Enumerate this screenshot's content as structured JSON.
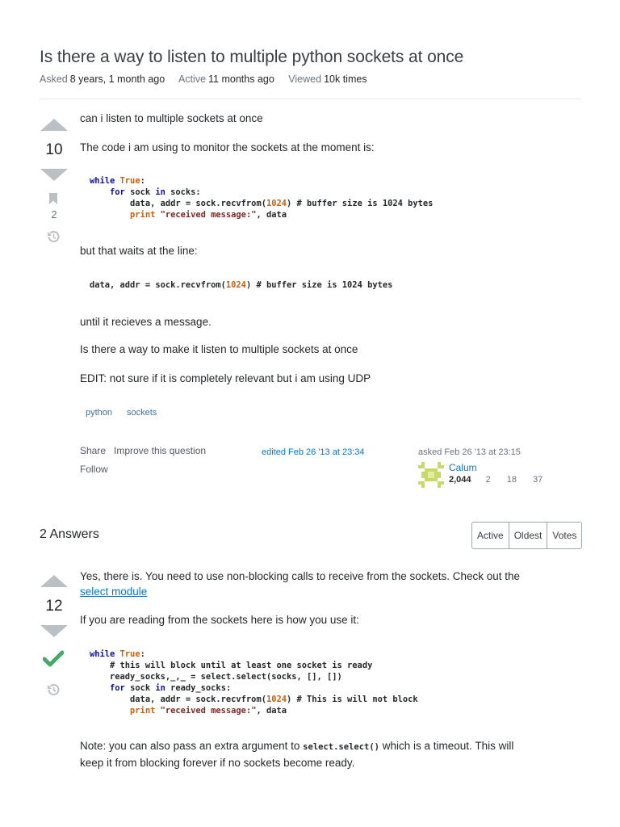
{
  "question": {
    "title": "Is there a way to listen to multiple python sockets at once",
    "meta": {
      "asked_label": "Asked",
      "asked_value": "8 years, 1 month ago",
      "active_label": "Active",
      "active_value": "11 months ago",
      "viewed_label": "Viewed",
      "viewed_value": "10k times"
    },
    "votes": "10",
    "bookmarks": "2",
    "paragraphs": {
      "p1": "can i listen to multiple sockets at once",
      "p2": "The code i am using to monitor the sockets at the moment is:",
      "p3": "but that waits at the line:",
      "p4": "until it recieves a message.",
      "p5": "Is there a way to make it listen to multiple sockets at once",
      "p6": "EDIT: not sure if it is completely relevant but i am using UDP"
    },
    "tags": [
      "python",
      "sockets"
    ],
    "actions": {
      "share": "Share",
      "improve": "Improve this question",
      "follow": "Follow"
    },
    "edited": "edited Feb 26 '13 at 23:34",
    "asked": "asked Feb 26 '13 at 23:15",
    "user": {
      "name": "Calum",
      "rep": "2,044",
      "gold": "2",
      "silver": "18",
      "bronze": "37"
    }
  },
  "answers_header": {
    "count_label": "2 Answers",
    "sort": [
      "Active",
      "Oldest",
      "Votes"
    ]
  },
  "answer": {
    "votes": "12",
    "p1_text": "Yes, there is. You need to use non-blocking calls to receive from the sockets. Check out the",
    "p1_link": "select module",
    "p2": "If you are reading from the sockets here is how you use it:",
    "p3_before": "Note: you can also pass an extra argument to",
    "p3_code": "select.select()",
    "p3_after": "which is a timeout. This will",
    "p3_line2": "keep it from blocking forever if no sockets become ready."
  },
  "colors": {
    "accent": "#0077cc",
    "accepted": "#48a868",
    "vote_arrow": "#bbc0c4"
  },
  "icons": [
    "bookmark-icon",
    "history-icon",
    "accepted-check-icon",
    "user-identicon"
  ]
}
